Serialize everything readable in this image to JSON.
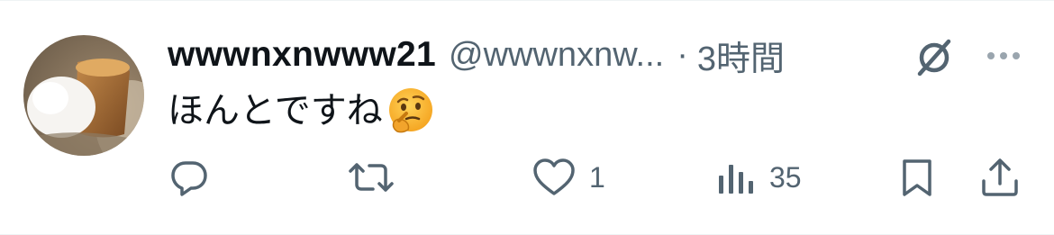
{
  "post": {
    "display_name": "wwwnxnwww21",
    "handle": "@wwwnxnw...",
    "separator": "·",
    "time": "3時間",
    "text": "ほんとですね",
    "emoji": "thinking-face-emoji"
  },
  "actions": {
    "reply_icon": "reply-icon",
    "repost_icon": "repost-icon",
    "like_icon": "heart-icon",
    "like_count": "1",
    "views_icon": "views-icon",
    "views_count": "35",
    "bookmark_icon": "bookmark-icon",
    "share_icon": "share-icon"
  },
  "header_icons": {
    "grok": "grok-icon",
    "more": "more-dots-icon"
  },
  "colors": {
    "text_primary": "#0f1419",
    "text_secondary": "#536471",
    "divider": "#eff3f4"
  }
}
